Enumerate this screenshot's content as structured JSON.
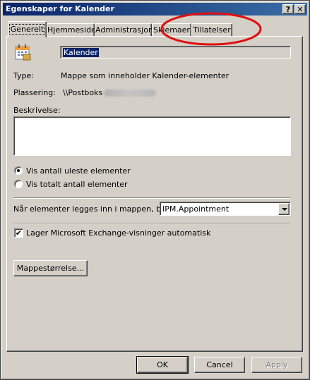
{
  "window": {
    "title": "Egenskaper for Kalender",
    "help_label": "?",
    "close_label": "✕"
  },
  "tabs": [
    {
      "label": "Generelt",
      "active": true
    },
    {
      "label": "Hjemmeside"
    },
    {
      "label": "Administrasjon"
    },
    {
      "label": "Skjemaer"
    },
    {
      "label": "Tillatelser"
    }
  ],
  "general": {
    "folder_icon": "calendar-icon",
    "folder_name": "Kalender",
    "type_label": "Type:",
    "type_value": "Mappe som inneholder Kalender-elementer",
    "location_label": "Plassering:",
    "location_value": "\\\\Postboks - ",
    "description_label": "Beskrivelse:",
    "description_value": "",
    "radio_unread": "Vis antall uleste elementer",
    "radio_total": "Vis totalt antall elementer",
    "post_label": "Når elementer legges inn i mappen, bruk:",
    "post_value": "IPM.Appointment",
    "auto_views_label": "Lager Microsoft Exchange-visninger automatisk",
    "auto_views_checked": true,
    "folder_size_button": "Mappestørrelse..."
  },
  "footer": {
    "ok": "OK",
    "cancel": "Cancel",
    "apply": "Apply"
  },
  "annotation": {
    "color": "#e01010",
    "shape": "ellipse"
  }
}
